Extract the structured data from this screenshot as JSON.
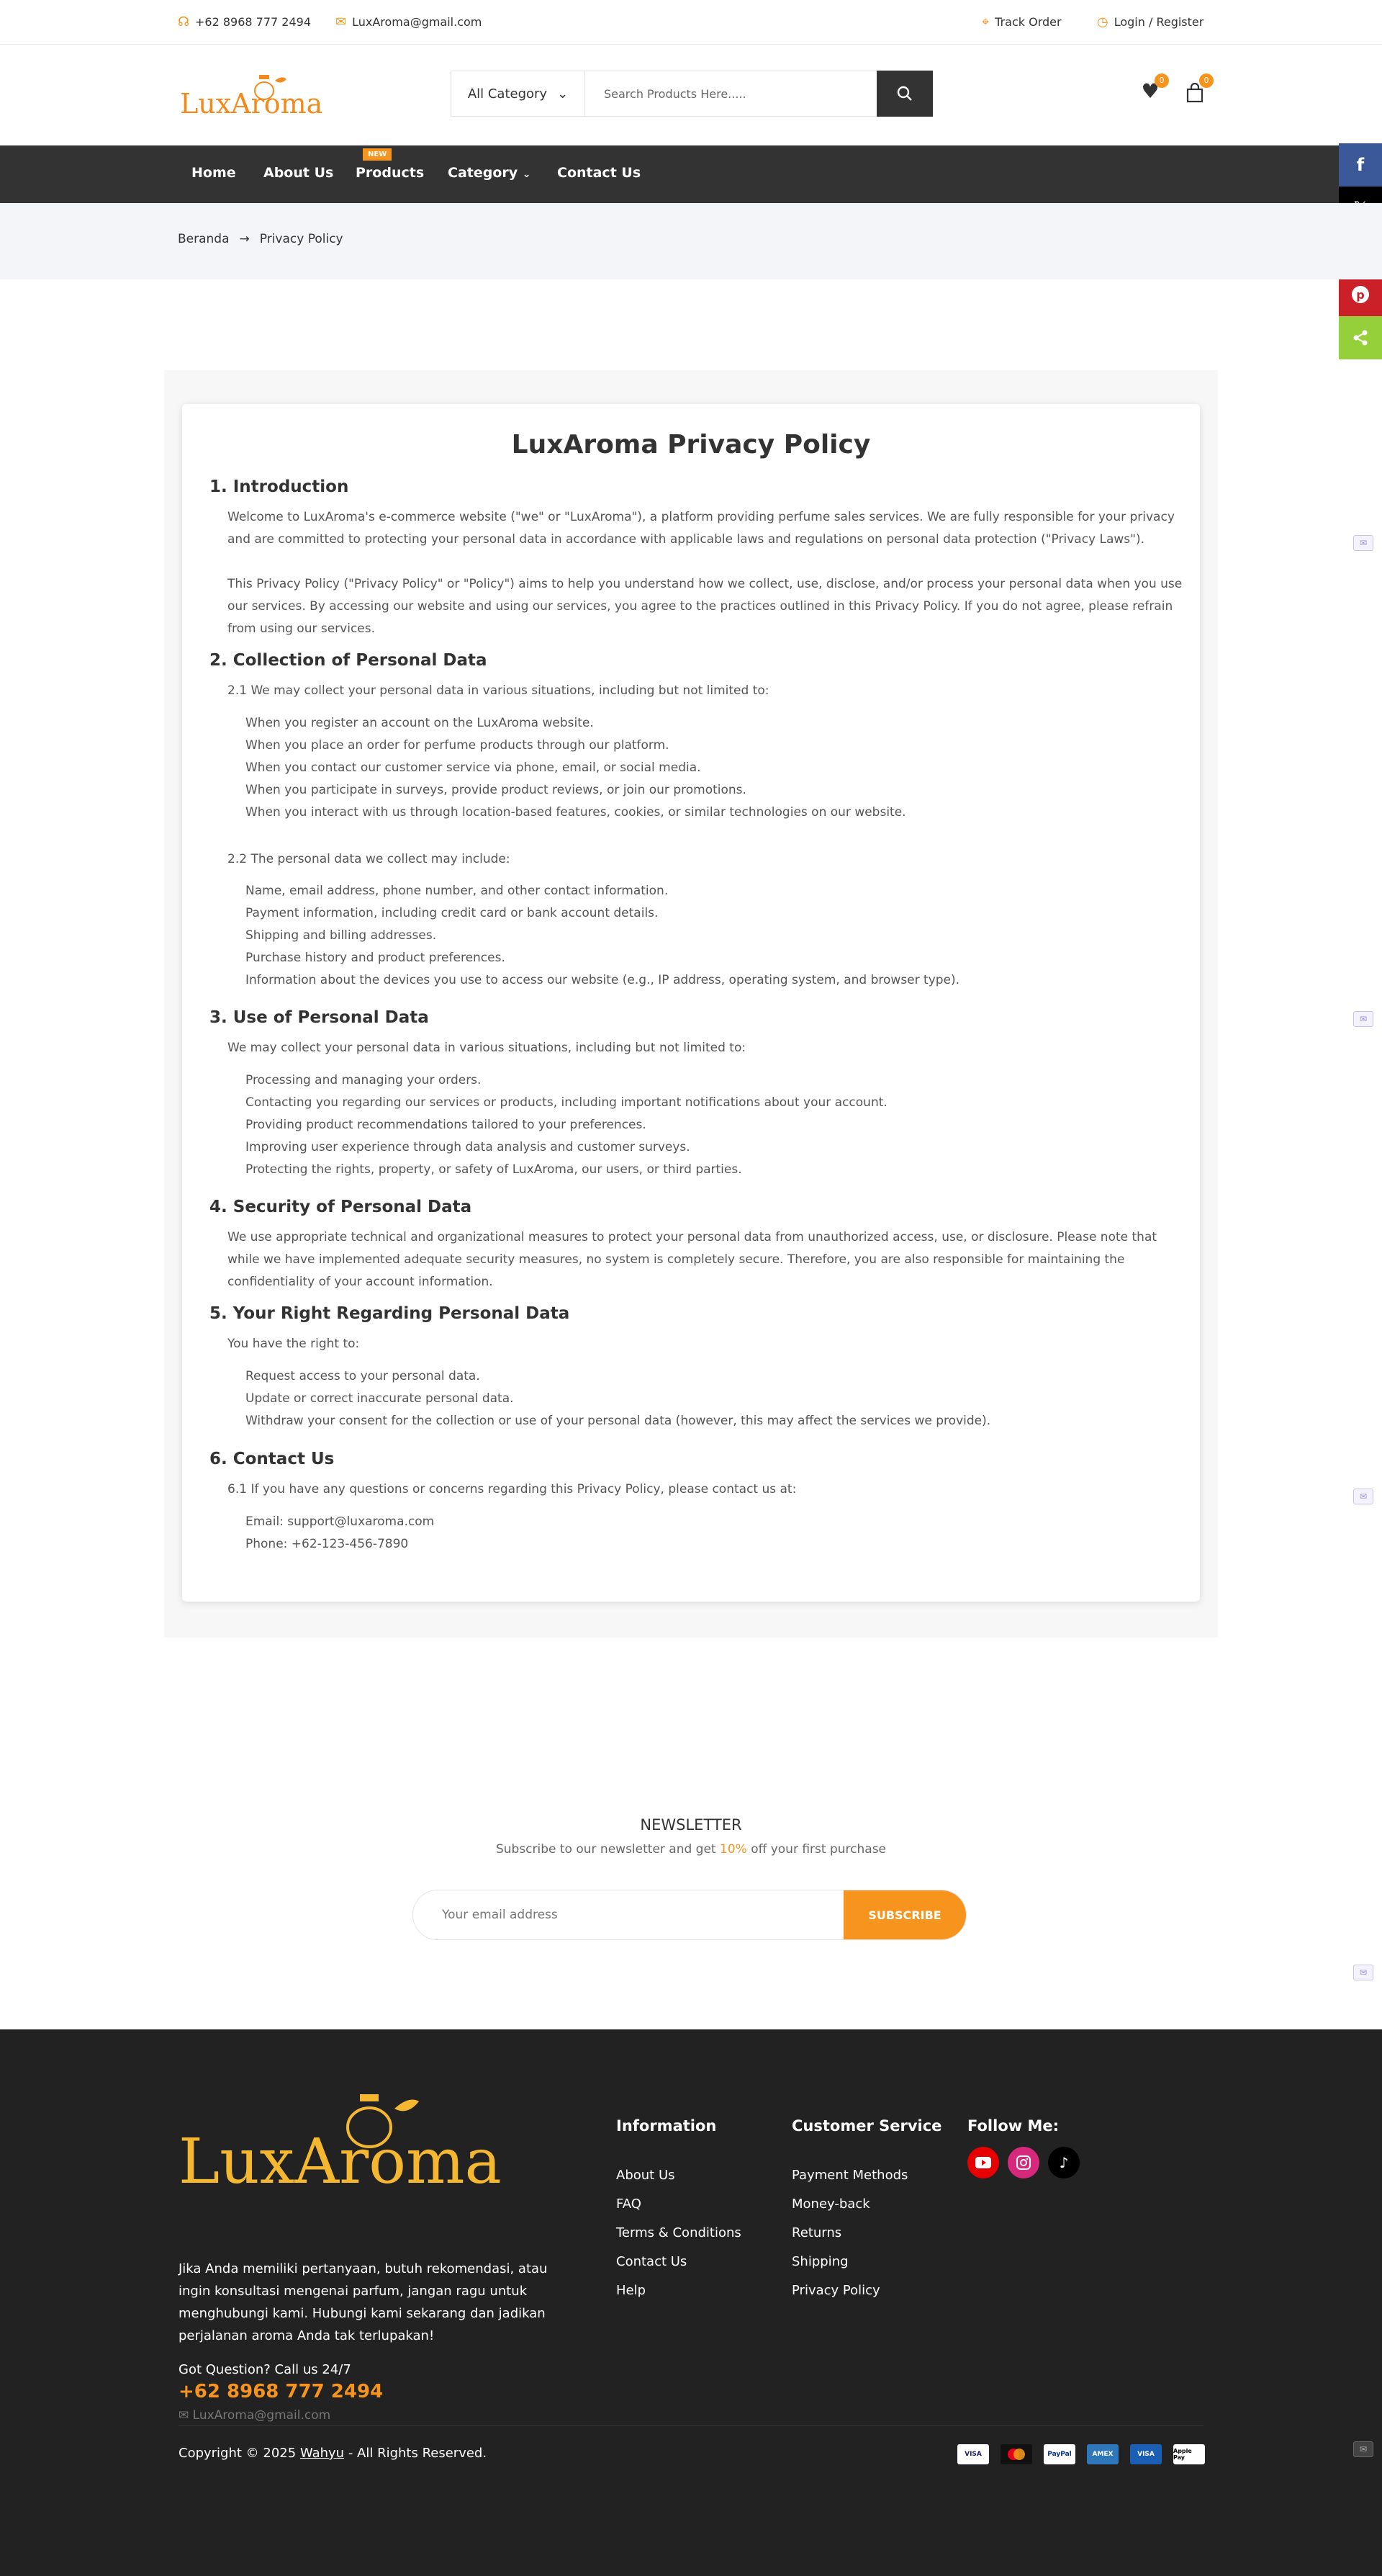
{
  "topbar": {
    "phone": "+62 8968 777 2494",
    "email": "LuxAroma@gmail.com",
    "track_order": "Track Order",
    "login_register": "Login / Register"
  },
  "header": {
    "logo_text": "LuxAroma",
    "category_label": "All Category",
    "search_placeholder": "Search Products Here.....",
    "wishlist_count": "0",
    "cart_count": "0"
  },
  "nav": {
    "home": "Home",
    "about": "About Us",
    "products": "Products",
    "products_badge": "NEW",
    "category": "Category",
    "contact": "Contact Us"
  },
  "breadcrumb": {
    "home": "Beranda",
    "current": "Privacy Policy"
  },
  "policy": {
    "title": "LuxAroma Privacy Policy",
    "s1": {
      "heading": "1. Introduction",
      "p1": "Welcome to LuxAroma's e-commerce website (\"we\" or \"LuxAroma\"), a platform providing perfume sales services. We are fully responsible for your privacy and are committed to protecting your personal data in accordance with applicable laws and regulations on personal data protection (\"Privacy Laws\").",
      "p2": "This Privacy Policy (\"Privacy Policy\" or \"Policy\") aims to help you understand how we collect, use, disclose, and/or process your personal data when you use our services. By accessing our website and using our services, you agree to the practices outlined in this Privacy Policy. If you do not agree, please refrain from using our services."
    },
    "s2": {
      "heading": "2. Collection of Personal Data",
      "intro1": "2.1 We may collect your personal data in various situations, including but not limited to:",
      "list1": [
        "When you register an account on the LuxAroma website.",
        "When you place an order for perfume products through our platform.",
        "When you contact our customer service via phone, email, or social media.",
        "When you participate in surveys, provide product reviews, or join our promotions.",
        "When you interact with us through location-based features, cookies, or similar technologies on our website."
      ],
      "intro2": "2.2 The personal data we collect may include:",
      "list2": [
        "Name, email address, phone number, and other contact information.",
        "Payment information, including credit card or bank account details.",
        "Shipping and billing addresses.",
        "Purchase history and product preferences.",
        "Information about the devices you use to access our website (e.g., IP address, operating system, and browser type)."
      ]
    },
    "s3": {
      "heading": "3. Use of Personal Data",
      "intro": "We may collect your personal data in various situations, including but not limited to:",
      "list": [
        "Processing and managing your orders.",
        "Contacting you regarding our services or products, including important notifications about your account.",
        "Providing product recommendations tailored to your preferences.",
        "Improving user experience through data analysis and customer surveys.",
        "Protecting the rights, property, or safety of LuxAroma, our users, or third parties."
      ]
    },
    "s4": {
      "heading": "4. Security of Personal Data",
      "p": "We use appropriate technical and organizational measures to protect your personal data from unauthorized access, use, or disclosure. Please note that while we have implemented adequate security measures, no system is completely secure. Therefore, you are also responsible for maintaining the confidentiality of your account information."
    },
    "s5": {
      "heading": "5. Your Right Regarding Personal Data",
      "intro": "You have the right to:",
      "list": [
        "Request access to your personal data.",
        "Update or correct inaccurate personal data.",
        "Withdraw your consent for the collection or use of your personal data (however, this may affect the services we provide)."
      ]
    },
    "s6": {
      "heading": "6. Contact Us",
      "intro": "6.1 If you have any questions or concerns regarding this Privacy Policy, please contact us at:",
      "email": "Email: support@luxaroma.com",
      "phone": "Phone: +62-123-456-7890"
    }
  },
  "newsletter": {
    "title": "NEWSLETTER",
    "sub_before": "Subscribe to our newsletter and get ",
    "sub_highlight": "10%",
    "sub_after": " off your first purchase",
    "placeholder": "Your email address",
    "button": "SUBSCRIBE"
  },
  "footer": {
    "logo_text": "LuxAroma",
    "description": "Jika Anda memiliki pertanyaan, butuh rekomendasi, atau ingin konsultasi mengenai parfum, jangan ragu untuk menghubungi kami. Hubungi kami sekarang dan jadikan perjalanan aroma Anda tak terlupakan!",
    "question": "Got Question? Call us 24/7",
    "phone": "+62 8968 777 2494",
    "email": "LuxAroma@gmail.com",
    "info_heading": "Information",
    "info_links": [
      "About Us",
      "FAQ",
      "Terms & Conditions",
      "Contact Us",
      "Help"
    ],
    "cs_heading": "Customer Service",
    "cs_links": [
      "Payment Methods",
      "Money-back",
      "Returns",
      "Shipping",
      "Privacy Policy"
    ],
    "follow_heading": "Follow Me:",
    "copyright_before": "Copyright © 2025 ",
    "copyright_link": "Wahyu",
    "copyright_after": " - All Rights Reserved.",
    "payments": [
      "VISA",
      "mastercard",
      "PayPal",
      "AMEX",
      "VISA",
      "Apple Pay"
    ]
  },
  "colors": {
    "accent": "#f7941d",
    "nav_bg": "#333333",
    "footer_bg": "#222222",
    "facebook": "#3b5998",
    "twitter": "#000000",
    "messenger": "#448aff",
    "pinterest": "#cb2027",
    "share": "#95d03a"
  },
  "icons": {
    "share_sidebar": [
      "facebook-icon",
      "x-icon",
      "messenger-icon",
      "pinterest-icon",
      "share-icon"
    ],
    "social": [
      "youtube-icon",
      "instagram-icon",
      "tiktok-icon"
    ]
  }
}
